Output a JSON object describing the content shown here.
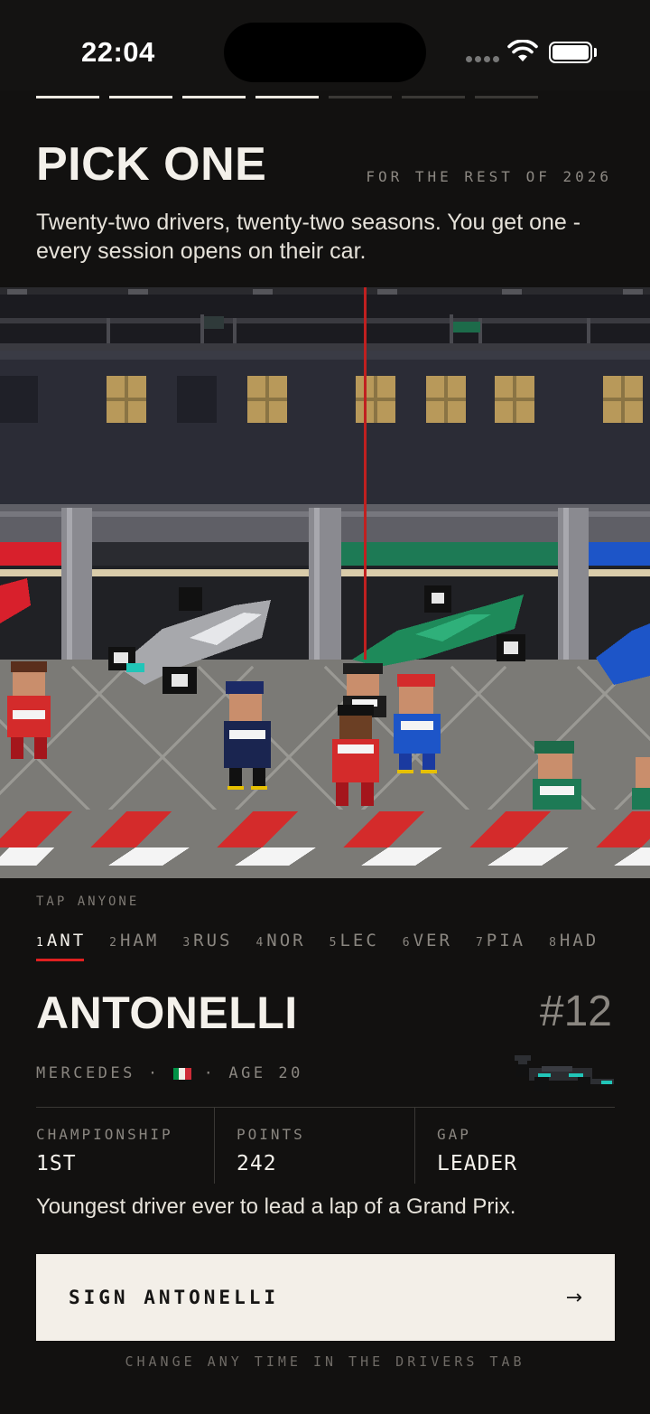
{
  "status": {
    "time": "22:04"
  },
  "progress": {
    "total": 7,
    "completed": 4
  },
  "header": {
    "title": "PICK ONE",
    "scope": "FOR THE REST OF 2026",
    "lead": "Twenty-two drivers, twenty-two seasons. You get one - every session opens on their car."
  },
  "picker": {
    "hint": "TAP ANYONE",
    "tabs": [
      {
        "num": "1",
        "code": "ANT"
      },
      {
        "num": "2",
        "code": "HAM"
      },
      {
        "num": "3",
        "code": "RUS"
      },
      {
        "num": "4",
        "code": "NOR"
      },
      {
        "num": "5",
        "code": "LEC"
      },
      {
        "num": "6",
        "code": "VER"
      },
      {
        "num": "7",
        "code": "PIA"
      },
      {
        "num": "8",
        "code": "HAD"
      }
    ],
    "selected_index": 0
  },
  "driver": {
    "name": "ANTONELLI",
    "number": "#12",
    "team": "MERCEDES",
    "age": "AGE 20",
    "flag_icon": "italy-flag-icon",
    "flag_colors": [
      "#009246",
      "#f1eee8",
      "#ce2b37"
    ],
    "stats": [
      {
        "label": "CHAMPIONSHIP",
        "value": "1ST"
      },
      {
        "label": "POINTS",
        "value": "242"
      },
      {
        "label": "GAP",
        "value": "LEADER"
      }
    ],
    "fact": "Youngest driver ever to lead a lap of a Grand Prix."
  },
  "cta": {
    "label": "SIGN ANTONELLI",
    "icon": "arrow-right-icon"
  },
  "footer": "CHANGE ANY TIME IN THE DRIVERS TAB",
  "colors": {
    "accent": "#e02020",
    "background": "#121110",
    "button": "#f3efe8"
  }
}
